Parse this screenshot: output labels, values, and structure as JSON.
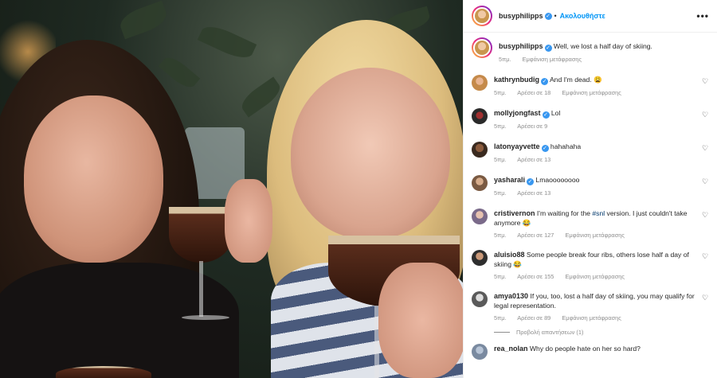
{
  "post": {
    "username": "busyphilipps",
    "follow_label": "Ακολουθήστε",
    "more_icon": "more-horizontal-icon"
  },
  "caption": {
    "username": "busyphilipps",
    "text": "Well, we lost a half day of skiing.",
    "time": "5πμ.",
    "translate": "Εμφάνιση μετάφρασης"
  },
  "comments": [
    {
      "username": "kathrynbudig",
      "verified": true,
      "text": "And I'm dead. 😩",
      "time": "5πμ.",
      "likes": "Αρέσει σε 18",
      "translate": "Εμφάνιση μετάφρασης"
    },
    {
      "username": "mollyjongfast",
      "verified": true,
      "text": "Lol",
      "time": "5πμ.",
      "likes": "Αρέσει σε 9"
    },
    {
      "username": "latonyayvette",
      "verified": true,
      "text": "hahahaha",
      "time": "5πμ.",
      "likes": "Αρέσει σε 13"
    },
    {
      "username": "yasharali",
      "verified": true,
      "text": "Lmaoooooooo",
      "time": "5πμ.",
      "likes": "Αρέσει σε 13"
    },
    {
      "username": "cristivernon",
      "verified": false,
      "text_before": "I'm waiting for the ",
      "hashtag": "#snl",
      "text_after": " version. I just couldn't take anymore 😂",
      "time": "5πμ.",
      "likes": "Αρέσει σε 127",
      "translate": "Εμφάνιση μετάφρασης"
    },
    {
      "username": "aluisio88",
      "verified": false,
      "text": "Some people break four ribs, others lose half a day of skiing 😂",
      "time": "5πμ.",
      "likes": "Αρέσει σε 155",
      "translate": "Εμφάνιση μετάφρασης"
    },
    {
      "username": "amya0130",
      "verified": false,
      "text": "If you, too, lost a half day of skiing, you may qualify for legal representation.",
      "time": "5πμ.",
      "likes": "Αρέσει σε 89",
      "translate": "Εμφάνιση μετάφρασης",
      "view_replies": "Προβολή απαντήσεων (1)"
    },
    {
      "username": "rea_nolan",
      "verified": false,
      "text": "Why do people hate on her so hard?"
    }
  ],
  "colors": {
    "link_blue": "#0095f6",
    "verified_blue": "#3897f0",
    "secondary_text": "#8e8e8e",
    "hashtag": "#00376b"
  }
}
